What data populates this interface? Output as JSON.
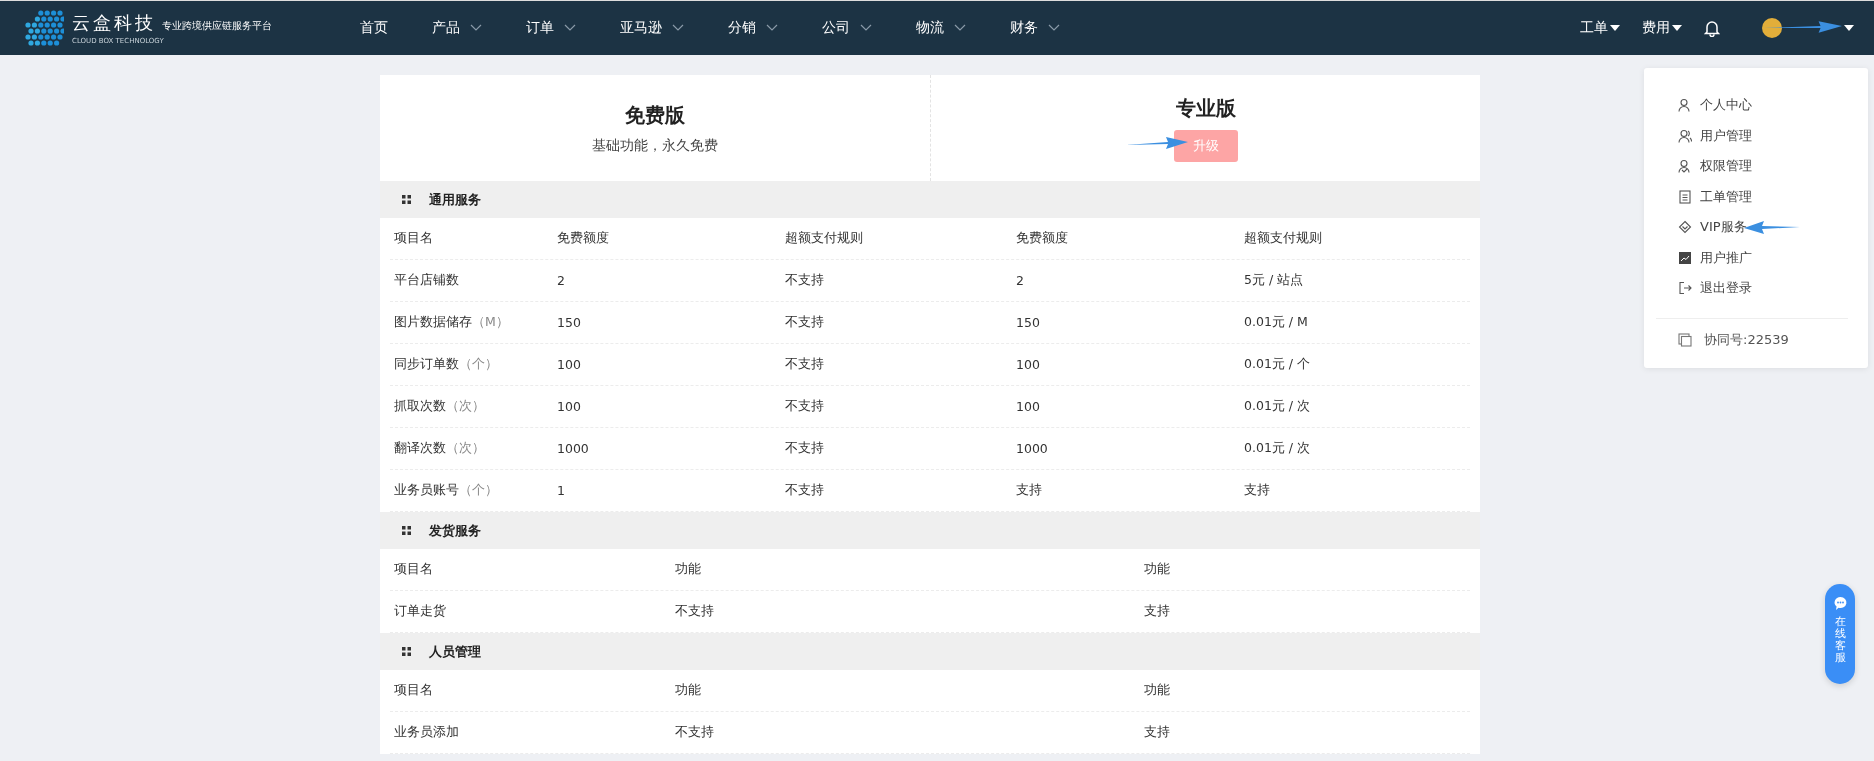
{
  "brand": {
    "name": "云盒科技",
    "tagline": "专业跨境供应链服务平台",
    "subtitle": "CLOUD BOX TECHNOLOGY"
  },
  "nav": [
    {
      "label": "首页",
      "dropdown": false
    },
    {
      "label": "产品",
      "dropdown": true
    },
    {
      "label": "订单",
      "dropdown": true
    },
    {
      "label": "亚马逊",
      "dropdown": true
    },
    {
      "label": "分销",
      "dropdown": true
    },
    {
      "label": "公司",
      "dropdown": true
    },
    {
      "label": "物流",
      "dropdown": true
    },
    {
      "label": "财务",
      "dropdown": true
    }
  ],
  "top_right": [
    {
      "label": "工单"
    },
    {
      "label": "费用"
    }
  ],
  "plans": [
    {
      "name": "免费版",
      "description": "基础功能，永久免费"
    },
    {
      "name": "专业版",
      "button": "升级"
    }
  ],
  "sections": [
    {
      "title": "通用服务",
      "columns": [
        "项目名",
        "免费额度",
        "超额支付规则",
        "免费额度",
        "超额支付规则"
      ],
      "rows": [
        {
          "cells": [
            "平台店铺数",
            "2",
            "不支持",
            "2",
            "5元 / 站点"
          ]
        },
        {
          "unit": "（M）",
          "cells": [
            "图片数据储存",
            "150",
            "不支持",
            "150",
            "0.01元 / M"
          ]
        },
        {
          "unit": "（个）",
          "cells": [
            "同步订单数",
            "100",
            "不支持",
            "100",
            "0.01元 / 个"
          ]
        },
        {
          "unit": "（次）",
          "cells": [
            "抓取次数",
            "100",
            "不支持",
            "100",
            "0.01元 / 次"
          ]
        },
        {
          "unit": "（次）",
          "cells": [
            "翻译次数",
            "1000",
            "不支持",
            "1000",
            "0.01元 / 次"
          ]
        },
        {
          "unit": "（个）",
          "cells": [
            "业务员账号",
            "1",
            "不支持",
            "支持",
            "支持"
          ]
        }
      ]
    },
    {
      "title": "发货服务",
      "columns": [
        "项目名",
        "功能",
        "功能"
      ],
      "rows": [
        {
          "cells": [
            "订单走货",
            "不支持",
            "支持"
          ]
        }
      ]
    },
    {
      "title": "人员管理",
      "columns": [
        "项目名",
        "功能",
        "功能"
      ],
      "rows": [
        {
          "cells": [
            "业务员添加",
            "不支持",
            "支持"
          ]
        }
      ]
    }
  ],
  "user_menu": {
    "items": [
      {
        "kind": "person",
        "label": "个人中心"
      },
      {
        "kind": "people",
        "label": "用户管理"
      },
      {
        "kind": "permission",
        "label": "权限管理"
      },
      {
        "kind": "ticket",
        "label": "工单管理"
      },
      {
        "kind": "vip",
        "label": "VIP服务"
      },
      {
        "kind": "promote",
        "label": "用户推广"
      },
      {
        "kind": "logout",
        "label": "退出登录"
      }
    ],
    "footer": "协同号:22539"
  },
  "chat_button": {
    "label": "在线客服"
  }
}
